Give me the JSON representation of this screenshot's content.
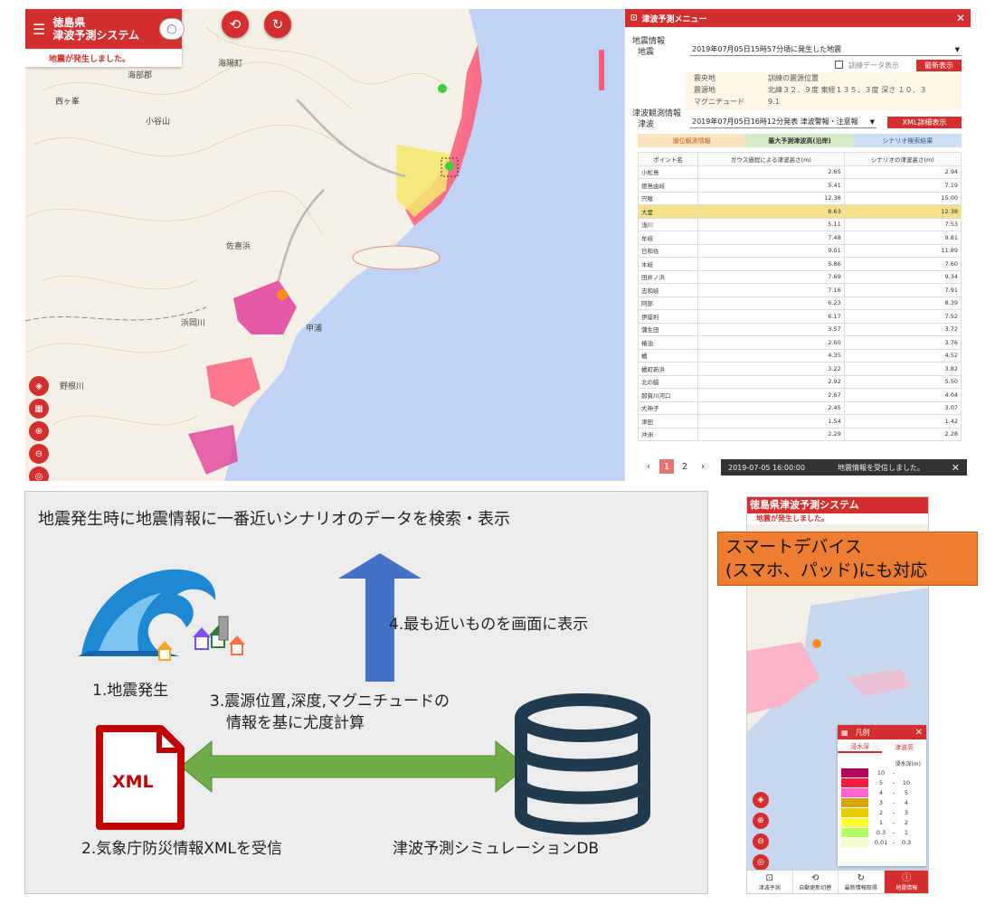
{
  "map": {
    "app_title_line1": "徳島県",
    "app_title_line2": "津波予測システム",
    "app_status": "地震が発生しました。",
    "toggle_label": "◯",
    "labels": [
      "海陽町",
      "海部郡",
      "西ヶ峯",
      "小谷山",
      "野根川",
      "浜岡川",
      "甲浦",
      "佐喜浜"
    ]
  },
  "panel": {
    "title": "津波予測メニュー",
    "quake_section": "地震情報",
    "quake_label": "地震",
    "quake_select": "2019年07月05日15時57分頃に発生した地震",
    "training_label": "訓練データ表示",
    "latest_button": "最新表示",
    "quake_rows": [
      {
        "k": "震央地",
        "v": "訓練の震源位置"
      },
      {
        "k": "震源地",
        "v": "北緯３２．９度 東経１３５．３度 深さ １０．３"
      },
      {
        "k": "マグニチュード",
        "v": "9.1"
      }
    ],
    "tsunami_section": "津波観測情報",
    "tsunami_label": "津波",
    "tsunami_select": "2019年07月05日16時12分発表 津波警報・注意報",
    "xml_button": "XML詳細表示",
    "tabs": [
      "潮位観測情報",
      "最大予測津波高(沿岸)",
      "シナリオ検索結果"
    ],
    "table_headers": [
      "ポイント名",
      "ガウス過程による津波高さ(m)",
      "シナリオの津波高さ(m)"
    ],
    "rows": [
      {
        "name": "小松島",
        "gp": "2.65",
        "sc": "2.94"
      },
      {
        "name": "徳島由岐",
        "gp": "5.41",
        "sc": "7.19"
      },
      {
        "name": "宍喰",
        "gp": "12.38",
        "sc": "15.00"
      },
      {
        "name": "大里",
        "gp": "8.63",
        "sc": "12.38"
      },
      {
        "name": "浅川",
        "gp": "5.11",
        "sc": "7.53"
      },
      {
        "name": "牟岐",
        "gp": "7.48",
        "sc": "9.81"
      },
      {
        "name": "日和佐",
        "gp": "9.01",
        "sc": "11.89"
      },
      {
        "name": "木岐",
        "gp": "5.86",
        "sc": "7.60"
      },
      {
        "name": "田井ノ浜",
        "gp": "7.69",
        "sc": "9.34"
      },
      {
        "name": "志和岐",
        "gp": "7.16",
        "sc": "7.91"
      },
      {
        "name": "阿部",
        "gp": "6.23",
        "sc": "8.39"
      },
      {
        "name": "伊座利",
        "gp": "6.17",
        "sc": "7.52"
      },
      {
        "name": "蒲生田",
        "gp": "3.57",
        "sc": "3.72"
      },
      {
        "name": "椿泊",
        "gp": "2.60",
        "sc": "3.76"
      },
      {
        "name": "橘",
        "gp": "4.35",
        "sc": "4.52"
      },
      {
        "name": "橘町新浜",
        "gp": "3.22",
        "sc": "3.82"
      },
      {
        "name": "北の脇",
        "gp": "2.92",
        "sc": "5.50"
      },
      {
        "name": "那賀川河口",
        "gp": "2.67",
        "sc": "4.04"
      },
      {
        "name": "大神子",
        "gp": "2.45",
        "sc": "3.07"
      },
      {
        "name": "津田",
        "gp": "1.54",
        "sc": "1.42"
      },
      {
        "name": "沖洲",
        "gp": "2.29",
        "sc": "2.28"
      }
    ],
    "pager": {
      "prev": "‹",
      "page1": "1",
      "page2": "2",
      "next": "›"
    },
    "toast_time": "2019-07-05 16:00:00",
    "toast_msg": "地震情報を受信しました。"
  },
  "diagram": {
    "title": "地震発生時に地震情報に一番近いシナリオのデータを検索・表示",
    "step1": "1.地震発生",
    "step2": "2.気象庁防災情報XMLを受信",
    "step3_line1": "3.震源位置,深度,マグニチュードの",
    "step3_line2": "情報を基に尤度計算",
    "step4": "4.最も近いものを画面に表示",
    "db_label": "津波予測シミュレーションDB",
    "xml_icon_text": "XML"
  },
  "phone": {
    "title": "徳島県津波予測システム",
    "status": "地震が発生しました。",
    "legend_title": "凡例",
    "legend_tabs": [
      "浸水深",
      "津波高"
    ],
    "legend_unit": "浸水深(m)",
    "legend_rows": [
      {
        "color": "#b0005a",
        "a": "10",
        "b": ""
      },
      {
        "color": "#ff1a3c",
        "a": "5",
        "b": "10"
      },
      {
        "color": "#ff66cc",
        "a": "4",
        "b": "5"
      },
      {
        "color": "#d4a800",
        "a": "3",
        "b": "4"
      },
      {
        "color": "#e6cc00",
        "a": "2",
        "b": "3"
      },
      {
        "color": "#ffff33",
        "a": "1",
        "b": "2"
      },
      {
        "color": "#b3ff66",
        "a": "0.3",
        "b": "1"
      },
      {
        "color": "#f0ffcc",
        "a": "0.01",
        "b": "0.3"
      }
    ],
    "bottom_bar": [
      "津波予測",
      "自動更新切替",
      "最新情報取得",
      "地震情報"
    ]
  },
  "callout": {
    "line1": "スマートデバイス",
    "line2": "(スマホ、パッド)にも対応"
  },
  "colors": {
    "brand_red": "#d32f2f",
    "arrow_blue": "#4472c4",
    "arrow_green": "#70ad47",
    "db_navy": "#1f3b4d",
    "xml_red": "#c00000",
    "callout_orange": "#ed7d31"
  }
}
